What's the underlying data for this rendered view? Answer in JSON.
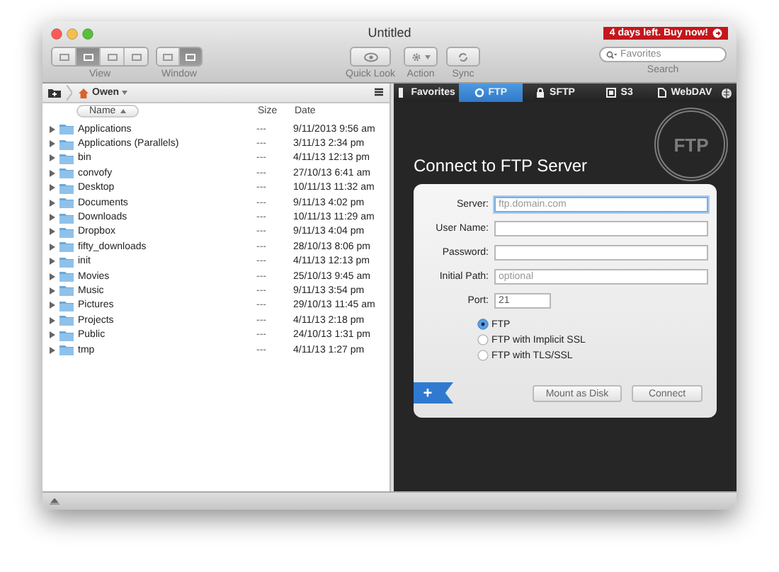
{
  "window": {
    "title": "Untitled",
    "trial_badge": "4 days left. Buy now!"
  },
  "toolbar": {
    "view_segments": [
      {
        "selected": false
      },
      {
        "selected": true
      },
      {
        "selected": false
      },
      {
        "selected": false
      }
    ],
    "view_label": "View",
    "window_segments": [
      {
        "selected": false
      },
      {
        "selected": true
      }
    ],
    "window_label": "Window",
    "buttons": [
      {
        "kind": "eye",
        "label": "Quick Look"
      },
      {
        "kind": "gear",
        "label": "Action"
      },
      {
        "kind": "sync",
        "label": "Sync"
      }
    ],
    "search": {
      "placeholder": "Favorites",
      "label": "Search"
    }
  },
  "browser": {
    "path": "Owen",
    "columns": [
      {
        "label": "Name",
        "sorted": true
      },
      {
        "label": "Size",
        "sorted": false
      },
      {
        "label": "Date",
        "sorted": false
      }
    ],
    "rows": [
      {
        "name": "Applications",
        "size": "---",
        "date": "9/11/2013 9:56 am"
      },
      {
        "name": "Applications (Parallels)",
        "size": "---",
        "date": "3/11/13 2:34 pm"
      },
      {
        "name": "bin",
        "size": "---",
        "date": "4/11/13 12:13 pm"
      },
      {
        "name": "convofy",
        "size": "---",
        "date": "27/10/13 6:41 am"
      },
      {
        "name": "Desktop",
        "size": "---",
        "date": "10/11/13 11:32 am"
      },
      {
        "name": "Documents",
        "size": "---",
        "date": "9/11/13 4:02 pm"
      },
      {
        "name": "Downloads",
        "size": "---",
        "date": "10/11/13 11:29 am"
      },
      {
        "name": "Dropbox",
        "size": "---",
        "date": "9/11/13 4:04 pm"
      },
      {
        "name": "fifty_downloads",
        "size": "---",
        "date": "28/10/13 8:06 pm"
      },
      {
        "name": "init",
        "size": "---",
        "date": "4/11/13 12:13 pm"
      },
      {
        "name": "Movies",
        "size": "---",
        "date": "25/10/13 9:45 am"
      },
      {
        "name": "Music",
        "size": "---",
        "date": "9/11/13 3:54 pm"
      },
      {
        "name": "Pictures",
        "size": "---",
        "date": "29/10/13 11:45 am"
      },
      {
        "name": "Projects",
        "size": "---",
        "date": "4/11/13 2:18 pm"
      },
      {
        "name": "Public",
        "size": "---",
        "date": "24/10/13 1:31 pm"
      },
      {
        "name": "tmp",
        "size": "---",
        "date": "4/11/13 1:27 pm"
      }
    ]
  },
  "tabs": [
    {
      "kind": "bookmark",
      "label": "Favorites",
      "selected": false
    },
    {
      "kind": "ring",
      "label": "FTP",
      "selected": true
    },
    {
      "kind": "lock",
      "label": "SFTP",
      "selected": false
    },
    {
      "kind": "box",
      "label": "S3",
      "selected": false
    },
    {
      "kind": "doc",
      "label": "WebDAV",
      "selected": false
    }
  ],
  "ftp": {
    "heading": "Connect to FTP Server",
    "stamp": "FTP",
    "fields": [
      {
        "label": "Server:",
        "placeholder": "ftp.domain.com",
        "focused": true
      },
      {
        "label": "User Name:",
        "focused": false
      },
      {
        "label": "Password:",
        "focused": false
      },
      {
        "label": "Initial Path:",
        "placeholder": "optional",
        "focused": false
      },
      {
        "label": "Port:",
        "value": "21",
        "short": true,
        "focused": false
      }
    ],
    "protocols": [
      {
        "label": "FTP",
        "selected": true
      },
      {
        "label": "FTP with Implicit SSL",
        "selected": false
      },
      {
        "label": "FTP with TLS/SSL",
        "selected": false
      }
    ],
    "add_label": "+",
    "buttons": [
      "Mount as Disk",
      "Connect"
    ]
  }
}
